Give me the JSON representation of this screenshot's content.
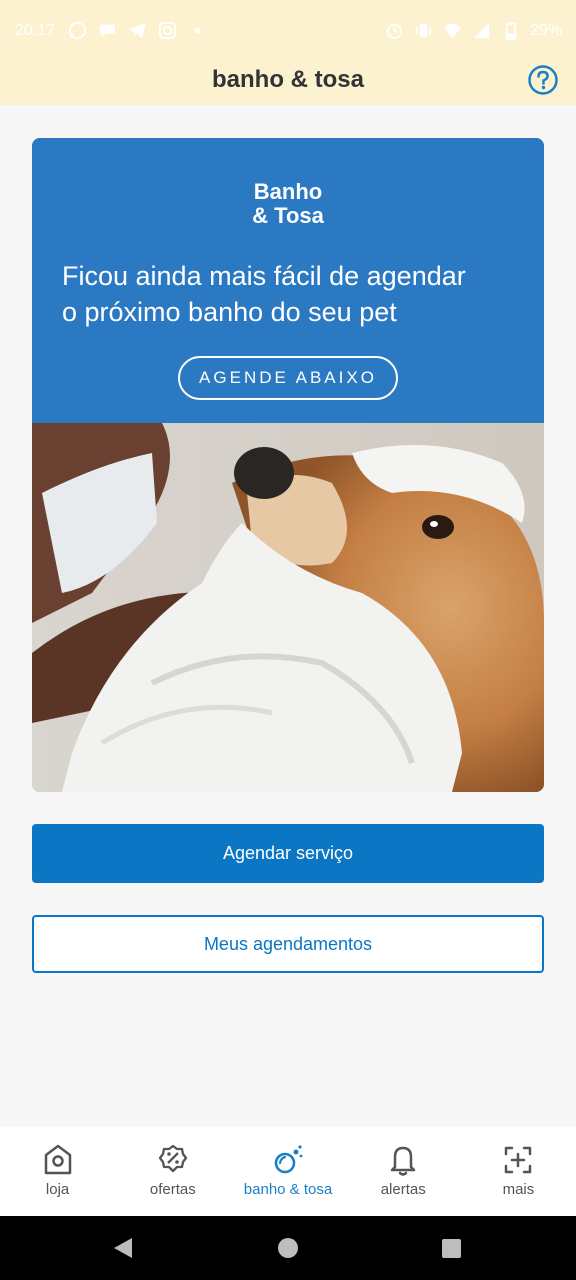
{
  "status_bar": {
    "time": "20:17",
    "battery": "29%",
    "left_icons": [
      "whatsapp-icon",
      "chat-bubble-icon",
      "telegram-icon",
      "instagram-icon",
      "dot-icon"
    ],
    "right_icons": [
      "alarm-icon",
      "vibrate-icon",
      "wifi-icon",
      "signal-icon",
      "battery-icon"
    ]
  },
  "header": {
    "title": "banho & tosa",
    "help_icon": "help-circle-icon"
  },
  "banner": {
    "brand_line1": "Banho",
    "brand_line2": "& Tosa",
    "headline_line1": "Ficou ainda mais fácil de agendar",
    "headline_line2": "o próximo banho do seu pet",
    "cta": "AGENDE ABAIXO",
    "image": "groomer-drying-golden-retriever-with-towel"
  },
  "actions": {
    "primary_label": "Agendar serviço",
    "secondary_label": "Meus agendamentos"
  },
  "bottom_nav": {
    "items": [
      {
        "label": "loja",
        "icon": "store-icon"
      },
      {
        "label": "ofertas",
        "icon": "discount-badge-icon"
      },
      {
        "label": "banho & tosa",
        "icon": "bath-bubbles-icon",
        "active": true
      },
      {
        "label": "alertas",
        "icon": "bell-icon"
      },
      {
        "label": "mais",
        "icon": "add-square-icon"
      }
    ]
  },
  "colors": {
    "header_bg": "#fcf2cf",
    "banner_blue": "#2b79c2",
    "primary": "#0b76c4",
    "active_nav": "#1a7fc6"
  }
}
